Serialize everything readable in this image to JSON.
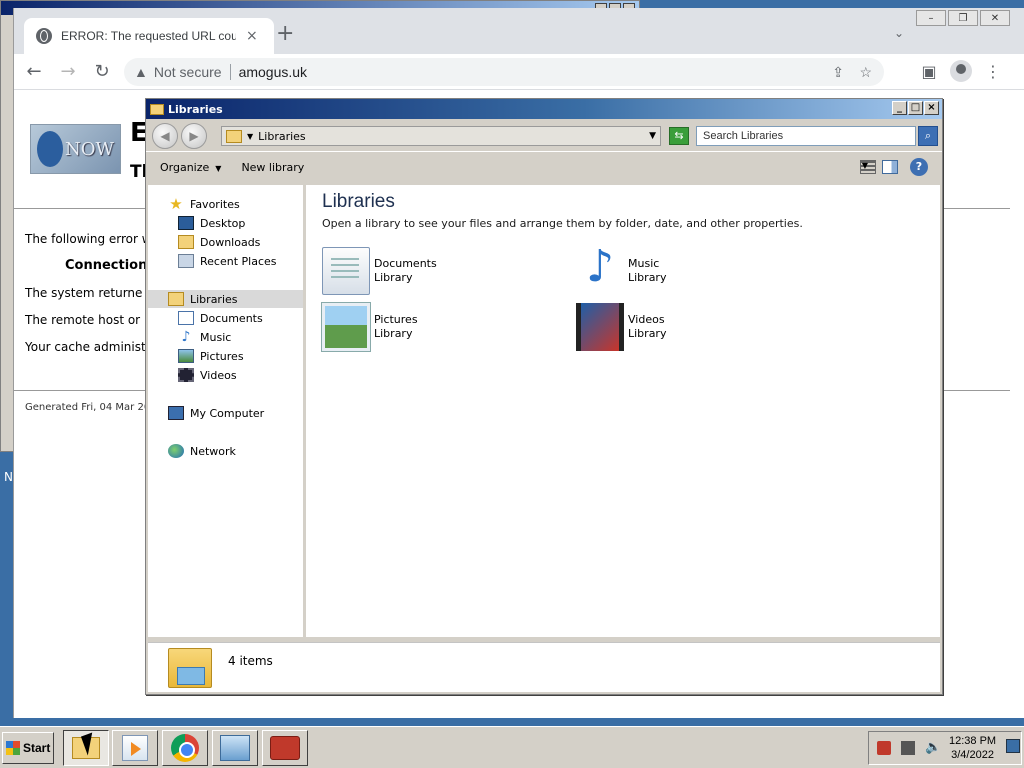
{
  "browser": {
    "tab_title": "ERROR: The requested URL could not be retrieved",
    "tab_close": "×",
    "new_tab": "+",
    "security_label": "Not secure",
    "url": "amogus.uk"
  },
  "error_page": {
    "logo_text": "NOW",
    "heading_char": "E",
    "subheading_char": "Tl",
    "lines": [
      "The following error w",
      "Connection",
      "The system returne",
      "The remote host or",
      "Your cache administ"
    ],
    "generated": "Generated Fri, 04 Mar 202"
  },
  "desktop": {
    "side_letter": "N"
  },
  "explorer": {
    "window_title": "Libraries",
    "address": "Libraries",
    "search_placeholder": "Search Libraries",
    "commands": {
      "organize": "Organize",
      "new_library": "New library"
    },
    "nav": {
      "favorites": "Favorites",
      "desktop": "Desktop",
      "downloads": "Downloads",
      "recent": "Recent Places",
      "libraries": "Libraries",
      "documents": "Documents",
      "music": "Music",
      "pictures": "Pictures",
      "videos": "Videos",
      "computer": "My Computer",
      "network": "Network"
    },
    "content": {
      "title": "Libraries",
      "description": "Open a library to see your files and arrange them by folder, date, and other properties.",
      "libraries": [
        {
          "name": "Documents",
          "type": "Library"
        },
        {
          "name": "Music",
          "type": "Library"
        },
        {
          "name": "Pictures",
          "type": "Library"
        },
        {
          "name": "Videos",
          "type": "Library"
        }
      ]
    },
    "details": {
      "count": "4 items"
    }
  },
  "taskbar": {
    "start": "Start",
    "time": "12:38 PM",
    "date": "3/4/2022"
  }
}
